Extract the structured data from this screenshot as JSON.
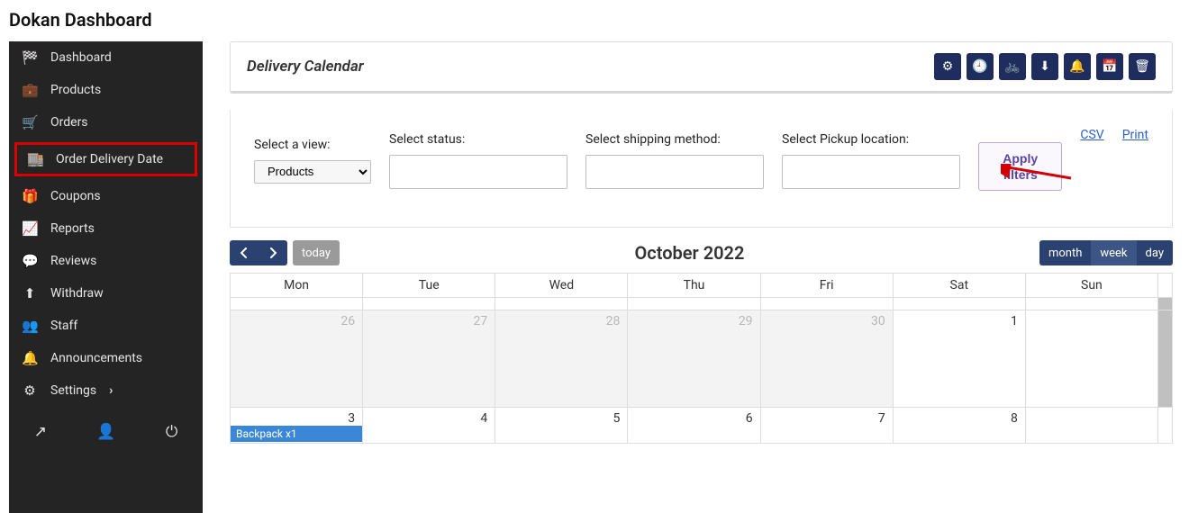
{
  "page_title": "Dokan Dashboard",
  "sidebar": {
    "items": [
      {
        "icon": "tachometer-icon",
        "label": "Dashboard",
        "glyph": "🏁"
      },
      {
        "icon": "briefcase-icon",
        "label": "Products",
        "glyph": "💼"
      },
      {
        "icon": "cart-icon",
        "label": "Orders",
        "glyph": "🛒"
      },
      {
        "icon": "store-icon",
        "label": "Order Delivery Date",
        "glyph": "🏬",
        "active": true
      },
      {
        "icon": "gift-icon",
        "label": "Coupons",
        "glyph": "🎁"
      },
      {
        "icon": "chart-icon",
        "label": "Reports",
        "glyph": "📈"
      },
      {
        "icon": "comment-icon",
        "label": "Reviews",
        "glyph": "💬"
      },
      {
        "icon": "upload-icon",
        "label": "Withdraw",
        "glyph": "⬆"
      },
      {
        "icon": "users-icon",
        "label": "Staff",
        "glyph": "👥"
      },
      {
        "icon": "bell-icon",
        "label": "Announcements",
        "glyph": "🔔"
      },
      {
        "icon": "cog-icon",
        "label": "Settings",
        "glyph": "⚙",
        "chevron": true
      }
    ],
    "footer_icons": [
      {
        "name": "external-link-icon",
        "glyph": "↗"
      },
      {
        "name": "user-icon",
        "glyph": "👤"
      },
      {
        "name": "power-icon",
        "glyph": "⏻"
      }
    ]
  },
  "panel": {
    "title": "Delivery Calendar",
    "header_icons": [
      {
        "name": "cog-icon",
        "glyph": "⚙"
      },
      {
        "name": "clock-icon",
        "glyph": "🕘"
      },
      {
        "name": "bicycle-icon",
        "glyph": "🚲"
      },
      {
        "name": "download-icon",
        "glyph": "⬇"
      },
      {
        "name": "bell-icon",
        "glyph": "🔔"
      },
      {
        "name": "calendar-icon",
        "glyph": "📅"
      },
      {
        "name": "archive-icon",
        "glyph": "🗑"
      }
    ]
  },
  "filters": {
    "view_label": "Select a view:",
    "status_label": "Select status:",
    "shipping_label": "Select shipping method:",
    "pickup_label": "Select Pickup location:",
    "view_value": "Products",
    "apply_label": "Apply filters",
    "csv_label": "CSV",
    "print_label": "Print"
  },
  "calendar": {
    "prev_glyph": "‹",
    "next_glyph": "›",
    "today_label": "today",
    "title": "October 2022",
    "views": {
      "month": "month",
      "week": "week",
      "day": "day",
      "active": "month"
    },
    "day_headers": [
      "Mon",
      "Tue",
      "Wed",
      "Thu",
      "Fri",
      "Sat",
      "Sun"
    ],
    "rows": [
      {
        "days": [
          {
            "n": "26",
            "other": true
          },
          {
            "n": "27",
            "other": true
          },
          {
            "n": "28",
            "other": true
          },
          {
            "n": "29",
            "other": true
          },
          {
            "n": "30",
            "other": true
          },
          {
            "n": "1"
          },
          {
            "n": ""
          }
        ]
      },
      {
        "days": [
          {
            "n": "3",
            "event": "Backpack x1"
          },
          {
            "n": "4"
          },
          {
            "n": "5"
          },
          {
            "n": "6"
          },
          {
            "n": "7"
          },
          {
            "n": "8"
          },
          {
            "n": ""
          }
        ]
      }
    ]
  }
}
